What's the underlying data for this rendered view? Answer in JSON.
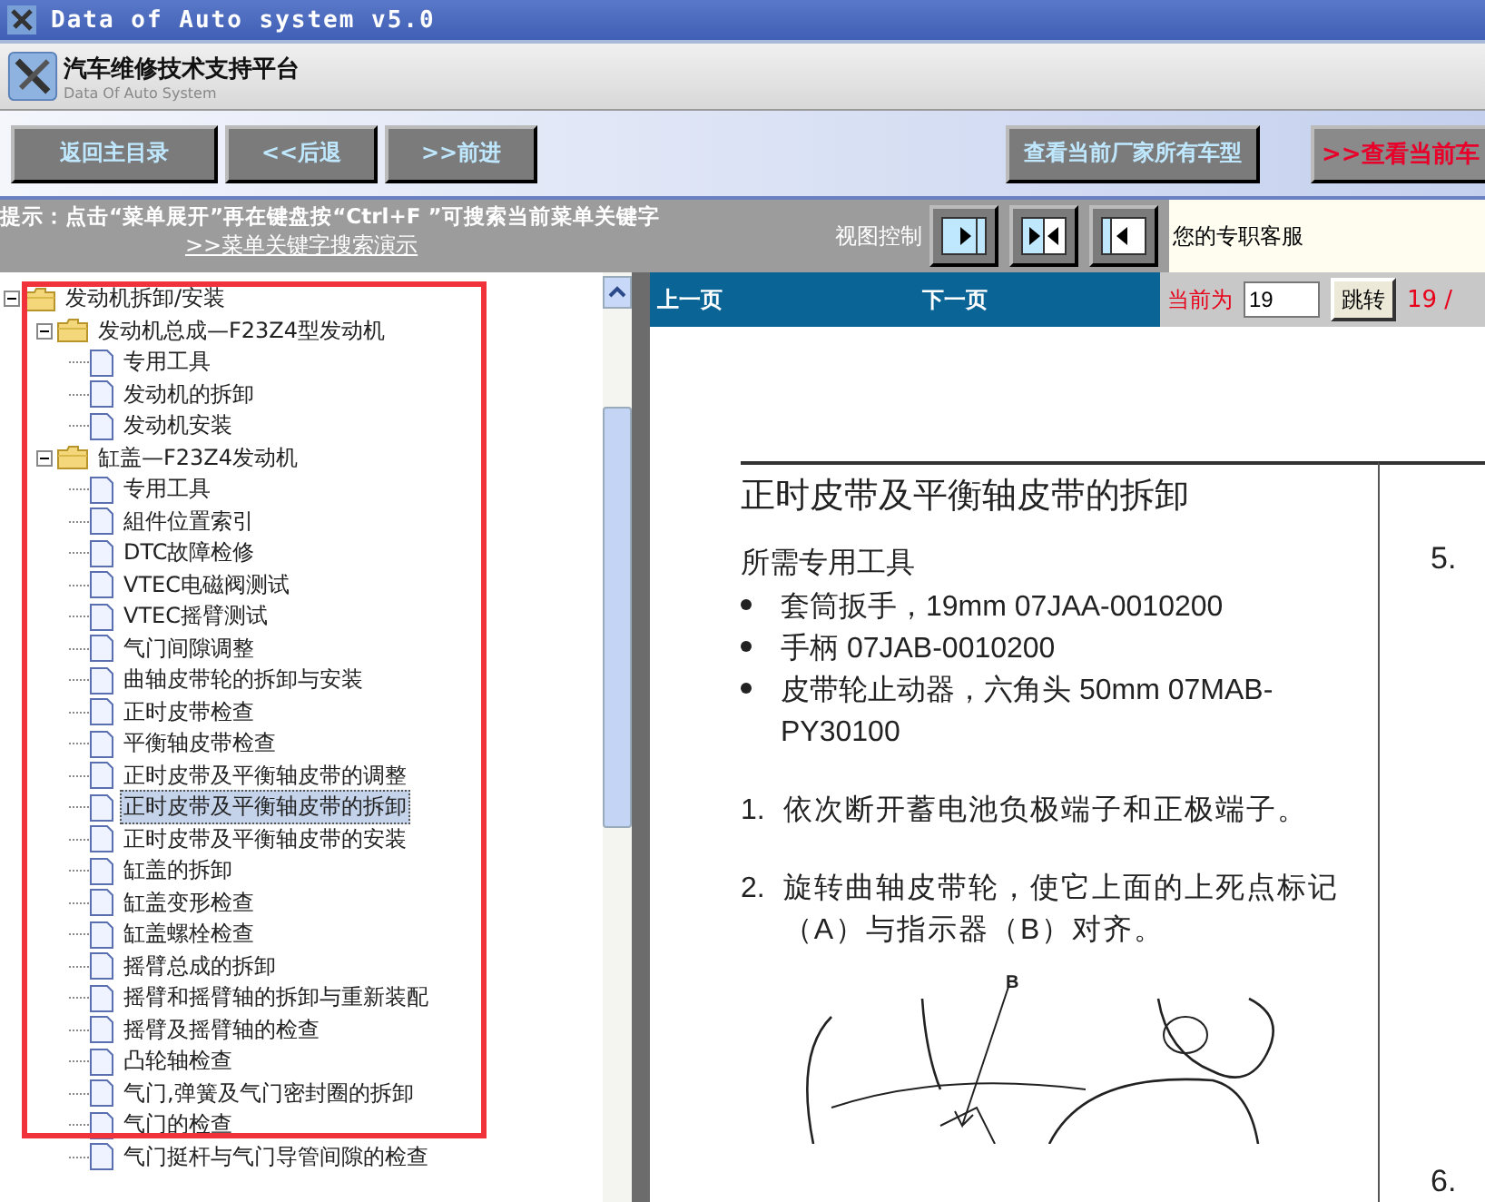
{
  "window": {
    "title": "Data of Auto system v5.0"
  },
  "header": {
    "title": "汽车维修技术支持平台",
    "subtitle": "Data Of Auto System"
  },
  "toolbar": {
    "left_buttons": [
      "返回主目录",
      "<<后退",
      ">>前进"
    ],
    "right_buttons": [
      {
        "label": "查看当前厂家所有车型",
        "kind": "normal"
      },
      {
        "label": ">>查看当前车",
        "kind": "alert"
      }
    ]
  },
  "hint": {
    "text": "提示：点击“菜单展开”再在键盘按“Ctrl+F ”可搜索当前菜单关键字",
    "link": ">>菜单关键字搜索演示"
  },
  "view_control": {
    "label": "视图控制",
    "buttons": [
      {
        "kind": "right"
      },
      {
        "kind": "both"
      },
      {
        "kind": "left"
      }
    ]
  },
  "service": {
    "text": "您的专职客服"
  },
  "tree": [
    {
      "label": "发动机拆卸/安装",
      "expanded": true,
      "selected": false,
      "children": [
        {
          "label": "发动机总成—F23Z4型发动机",
          "expanded": true,
          "selected": false,
          "children": [
            {
              "label": "专用工具",
              "selected": false
            },
            {
              "label": "发动机的拆卸",
              "selected": false
            },
            {
              "label": "发动机安装",
              "selected": false
            }
          ]
        },
        {
          "label": "缸盖—F23Z4发动机",
          "expanded": true,
          "selected": false,
          "children": [
            {
              "label": "专用工具",
              "selected": false
            },
            {
              "label": "組件位置索引",
              "selected": false
            },
            {
              "label": "DTC故障检修",
              "selected": false
            },
            {
              "label": "VTEC电磁阀测试",
              "selected": false
            },
            {
              "label": "VTEC摇臂测试",
              "selected": false
            },
            {
              "label": "气门间隙调整",
              "selected": false
            },
            {
              "label": "曲轴皮带轮的拆卸与安装",
              "selected": false
            },
            {
              "label": "正时皮带检查",
              "selected": false
            },
            {
              "label": "平衡轴皮带检查",
              "selected": false
            },
            {
              "label": "正时皮带及平衡轴皮带的调整",
              "selected": false
            },
            {
              "label": "正时皮带及平衡轴皮带的拆卸",
              "selected": true
            },
            {
              "label": "正时皮带及平衡轴皮带的安装",
              "selected": false
            },
            {
              "label": "缸盖的拆卸",
              "selected": false
            },
            {
              "label": "缸盖变形检查",
              "selected": false
            },
            {
              "label": "缸盖螺栓检查",
              "selected": false
            },
            {
              "label": "摇臂总成的拆卸",
              "selected": false
            },
            {
              "label": "摇臂和摇臂轴的拆卸与重新装配",
              "selected": false
            },
            {
              "label": "摇臂及摇臂轴的检查",
              "selected": false
            },
            {
              "label": "凸轮轴检查",
              "selected": false
            },
            {
              "label": "气门,弹簧及气门密封圈的拆卸",
              "selected": false
            },
            {
              "label": "气门的检查",
              "selected": false
            },
            {
              "label": "气门挺杆与气门导管间隙的检查",
              "selected": false
            }
          ]
        }
      ]
    }
  ],
  "pager": {
    "prev": "上一页",
    "next": "下一页",
    "current_label": "当前为",
    "page": "19",
    "go": "跳转",
    "total": "19 /"
  },
  "document": {
    "title": "正时皮带及平衡轴皮带的拆卸",
    "subtitle": "所需专用工具",
    "tools": [
      "套筒扳手，19mm 07JAA-0010200",
      "手柄 07JAB-0010200",
      "皮带轮止动器，六角头 50mm 07MAB-PY30100"
    ],
    "steps": [
      {
        "number": "1.",
        "text": "依次断开蓄电池负极端子和正极端子。"
      },
      {
        "number": "2.",
        "text": "旋转曲轴皮带轮，使它上面的上死点标记（A）与指示器（B）对齐。"
      }
    ],
    "figure_label": "B",
    "side_steps": [
      "5.",
      "6."
    ]
  }
}
